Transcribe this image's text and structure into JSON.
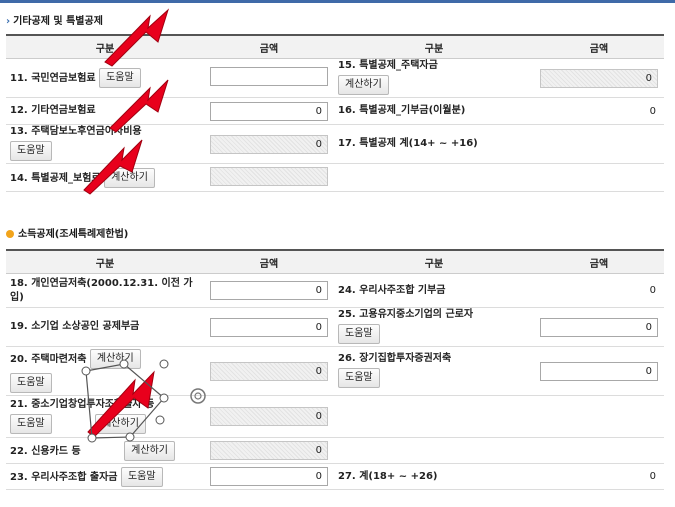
{
  "section1": {
    "title": "기타공제 및 특별공제",
    "headers": [
      "구분",
      "금액",
      "구분",
      "금액"
    ],
    "rows": [
      {
        "label": "11. 국민연금보험료",
        "button": "도움말",
        "value": "",
        "disabled": false,
        "label2": "15. 특별공제_주택자금",
        "button2": "계산하기",
        "value2": "0",
        "disabled2": true
      },
      {
        "label": "12. 기타연금보험료",
        "button": "",
        "value": "0",
        "disabled": false,
        "label2": "16. 특별공제_기부금(이월분)",
        "button2": "",
        "value2": "0",
        "plain2": true
      },
      {
        "label": "13. 주택담보노후연금이자비용",
        "button": "도움말",
        "value": "0",
        "disabled": true,
        "label2": "17. 특별공제 계(14+ ~ +16)",
        "button2": "",
        "value2": "",
        "plain2": true
      },
      {
        "label": "14. 특별공제_보험료",
        "button": "계산하기",
        "value": "",
        "disabled": true,
        "label2": "",
        "button2": "",
        "value2": "",
        "empty2": true
      }
    ]
  },
  "section2": {
    "title": "소득공제(조세특례제한법)",
    "headers": [
      "구분",
      "금액",
      "구분",
      "금액"
    ],
    "rows": [
      {
        "label": "18. 개인연금저축(2000.12.31. 이전 가입)",
        "button": "",
        "value": "0",
        "disabled": false,
        "label2": "24. 우리사주조합 기부금",
        "button2": "",
        "value2": "0",
        "plain2": true
      },
      {
        "label": "19. 소기업 소상공인 공제부금",
        "button": "",
        "value": "0",
        "disabled": false,
        "label2": "25. 고용유지중소기업의 근로자",
        "button2": "도움말",
        "value2": "0",
        "disabled2": false
      },
      {
        "label": "20. 주택마련저축",
        "button": "계산하기",
        "button_b": "도움말",
        "value": "0",
        "disabled": true,
        "label2": "26. 장기집합투자증권저축",
        "button2": "도움말",
        "value2": "0",
        "disabled2": false
      },
      {
        "label": "21. 중소기업창업투자조합출자 등",
        "button": "도움말",
        "button_r": "계산하기",
        "value": "0",
        "disabled": true,
        "label2": "",
        "button2": "",
        "value2": "",
        "empty2": true
      },
      {
        "label": "22. 신용카드 등",
        "button": "계산하기",
        "value": "0",
        "disabled": true,
        "label2": "",
        "button2": "",
        "value2": "",
        "empty2": true
      },
      {
        "label": "23. 우리사주조합 출자금",
        "button": "도움말",
        "value": "0",
        "disabled": false,
        "label2": "27. 계(18+ ~ +26)",
        "button2": "",
        "value2": "0",
        "plain2": true
      }
    ]
  },
  "colors": {
    "header_border": "#555555",
    "accent": "#3f6aa8",
    "annotation_red": "#e8001c"
  }
}
